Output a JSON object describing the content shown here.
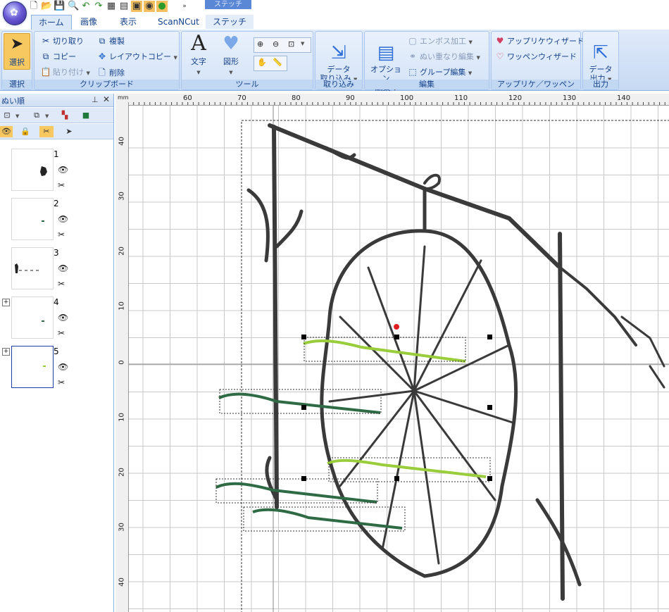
{
  "context_tab": "ステッチ",
  "tabs": [
    {
      "label": "ホーム",
      "active": true
    },
    {
      "label": "画像",
      "active": false
    },
    {
      "label": "表示",
      "active": false
    },
    {
      "label": "ScanNCut",
      "active": false
    },
    {
      "label": "ステッチ",
      "active": false
    }
  ],
  "ribbon": {
    "select_group": {
      "select_label": "選択",
      "group_label": "選択"
    },
    "clipboard": {
      "cut": "切り取り",
      "copy": "コピー",
      "paste": "貼り付け",
      "duplicate": "複製",
      "layout_copy": "レイアウトコピー",
      "delete": "削除",
      "group_label": "クリップボード"
    },
    "tools": {
      "text": "文字",
      "shape": "図形",
      "group_label": "ツール"
    },
    "import": {
      "data_import": "データ\n取り込み",
      "group_label": "取り込み"
    },
    "edit": {
      "option_edit": "オプション\n編集",
      "emboss": "エンボス加工",
      "overlap_edit": "ぬい重なり編集",
      "group_edit": "グループ編集",
      "group_label": "編集"
    },
    "applique": {
      "applique_wizard": "アップリケウィザード",
      "patch_wizard": "ワッペンウィザード",
      "group_label": "アップリケ／ワッペン"
    },
    "output": {
      "data_output": "データ\n出力",
      "group_label": "出力"
    }
  },
  "panel": {
    "title": "ぬい順",
    "items": [
      {
        "num": "1"
      },
      {
        "num": "2"
      },
      {
        "num": "3"
      },
      {
        "num": "4"
      },
      {
        "num": "5"
      }
    ]
  },
  "ruler": {
    "unit": "mm",
    "top_labels": [
      "60",
      "70",
      "80",
      "90",
      "100",
      "110",
      "120",
      "130",
      "140"
    ],
    "left_labels": [
      "40",
      "30",
      "20",
      "10",
      "0",
      "10",
      "20",
      "30",
      "40"
    ]
  },
  "colors": {
    "stitch_dark": "#3a3a3a",
    "stitch_light_green": "#9acd3c",
    "stitch_dark_green": "#2e6b45",
    "selection_center": "#e02020"
  }
}
